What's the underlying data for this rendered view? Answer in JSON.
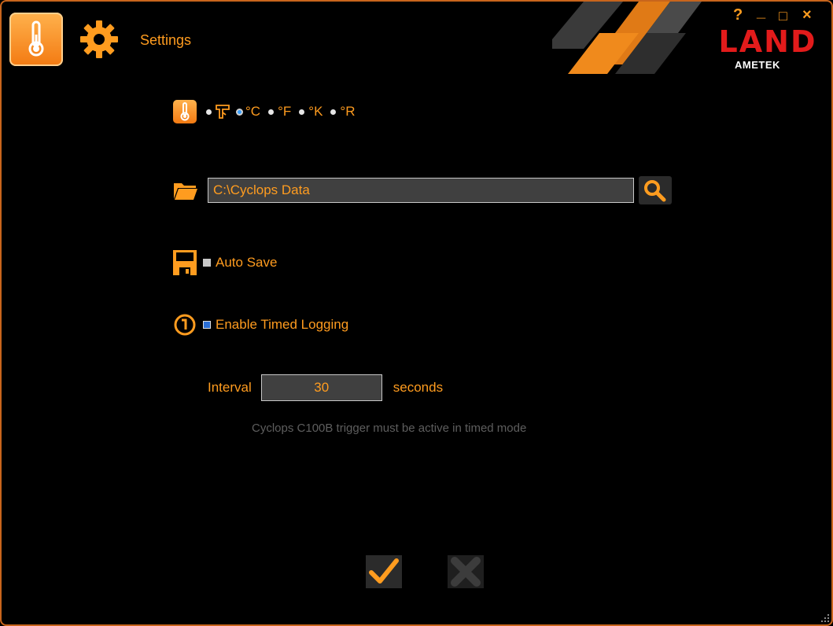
{
  "titlebar": {
    "title": "Settings",
    "help_label": "?",
    "minimize_label": "_",
    "maximize_label": "□",
    "close_label": "×",
    "brand": "LAND",
    "brand_sub": "AMETEK"
  },
  "units": {
    "options": [
      "°C",
      "°F",
      "°K",
      "°R"
    ],
    "selected": "°C"
  },
  "folder": {
    "path": "C:\\Cyclops Data"
  },
  "auto_save": {
    "label": "Auto Save",
    "checked": false
  },
  "timed_logging": {
    "label": "Enable Timed Logging",
    "checked": true
  },
  "interval": {
    "label": "Interval",
    "value": "30",
    "unit": "seconds",
    "note": "Cyclops C100B trigger must be active in timed mode"
  },
  "colors": {
    "accent": "#ff9c1f",
    "border": "#c8651c",
    "background": "#000000"
  },
  "icons": [
    "thermometer-icon",
    "gear-icon",
    "radiation-gun-icon",
    "folder-icon",
    "search-icon",
    "floppy-disk-icon",
    "timer-icon",
    "checkmark-icon",
    "close-icon"
  ]
}
